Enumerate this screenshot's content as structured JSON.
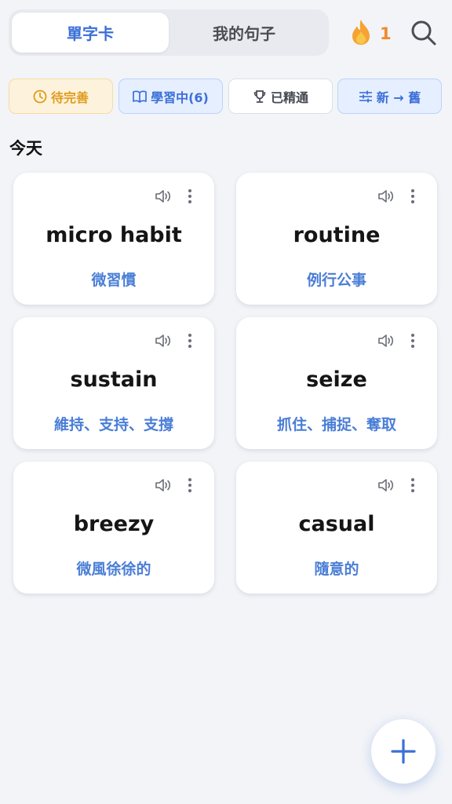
{
  "header": {
    "tabs": [
      {
        "label": "單字卡",
        "active": true
      },
      {
        "label": "我的句子",
        "active": false
      }
    ],
    "streak_count": "1",
    "icons": {
      "streak": "fire-icon",
      "search": "search-icon"
    }
  },
  "filters": {
    "pending": {
      "label": "待完善",
      "icon": "clock-icon"
    },
    "learning": {
      "label": "學習中(6)",
      "icon": "book-icon"
    },
    "mastered": {
      "label": "已精通",
      "icon": "trophy-icon"
    },
    "sort": {
      "label": "新 → 舊",
      "icon": "sliders-icon"
    }
  },
  "section": {
    "title": "今天"
  },
  "cards": [
    {
      "word": "micro habit",
      "meaning": "微習慣"
    },
    {
      "word": "routine",
      "meaning": "例行公事"
    },
    {
      "word": "sustain",
      "meaning": "維持、支持、支撐"
    },
    {
      "word": "seize",
      "meaning": "抓住、捕捉、奪取"
    },
    {
      "word": "breezy",
      "meaning": "微風徐徐的"
    },
    {
      "word": "casual",
      "meaning": "隨意的"
    }
  ],
  "colors": {
    "accent": "#3b6fd8",
    "meaning": "#4a7ed6",
    "pending": "#e09b1d",
    "streak": "#f08a2c",
    "background": "#f2f4f8"
  },
  "fab": {
    "icon": "plus-icon"
  }
}
